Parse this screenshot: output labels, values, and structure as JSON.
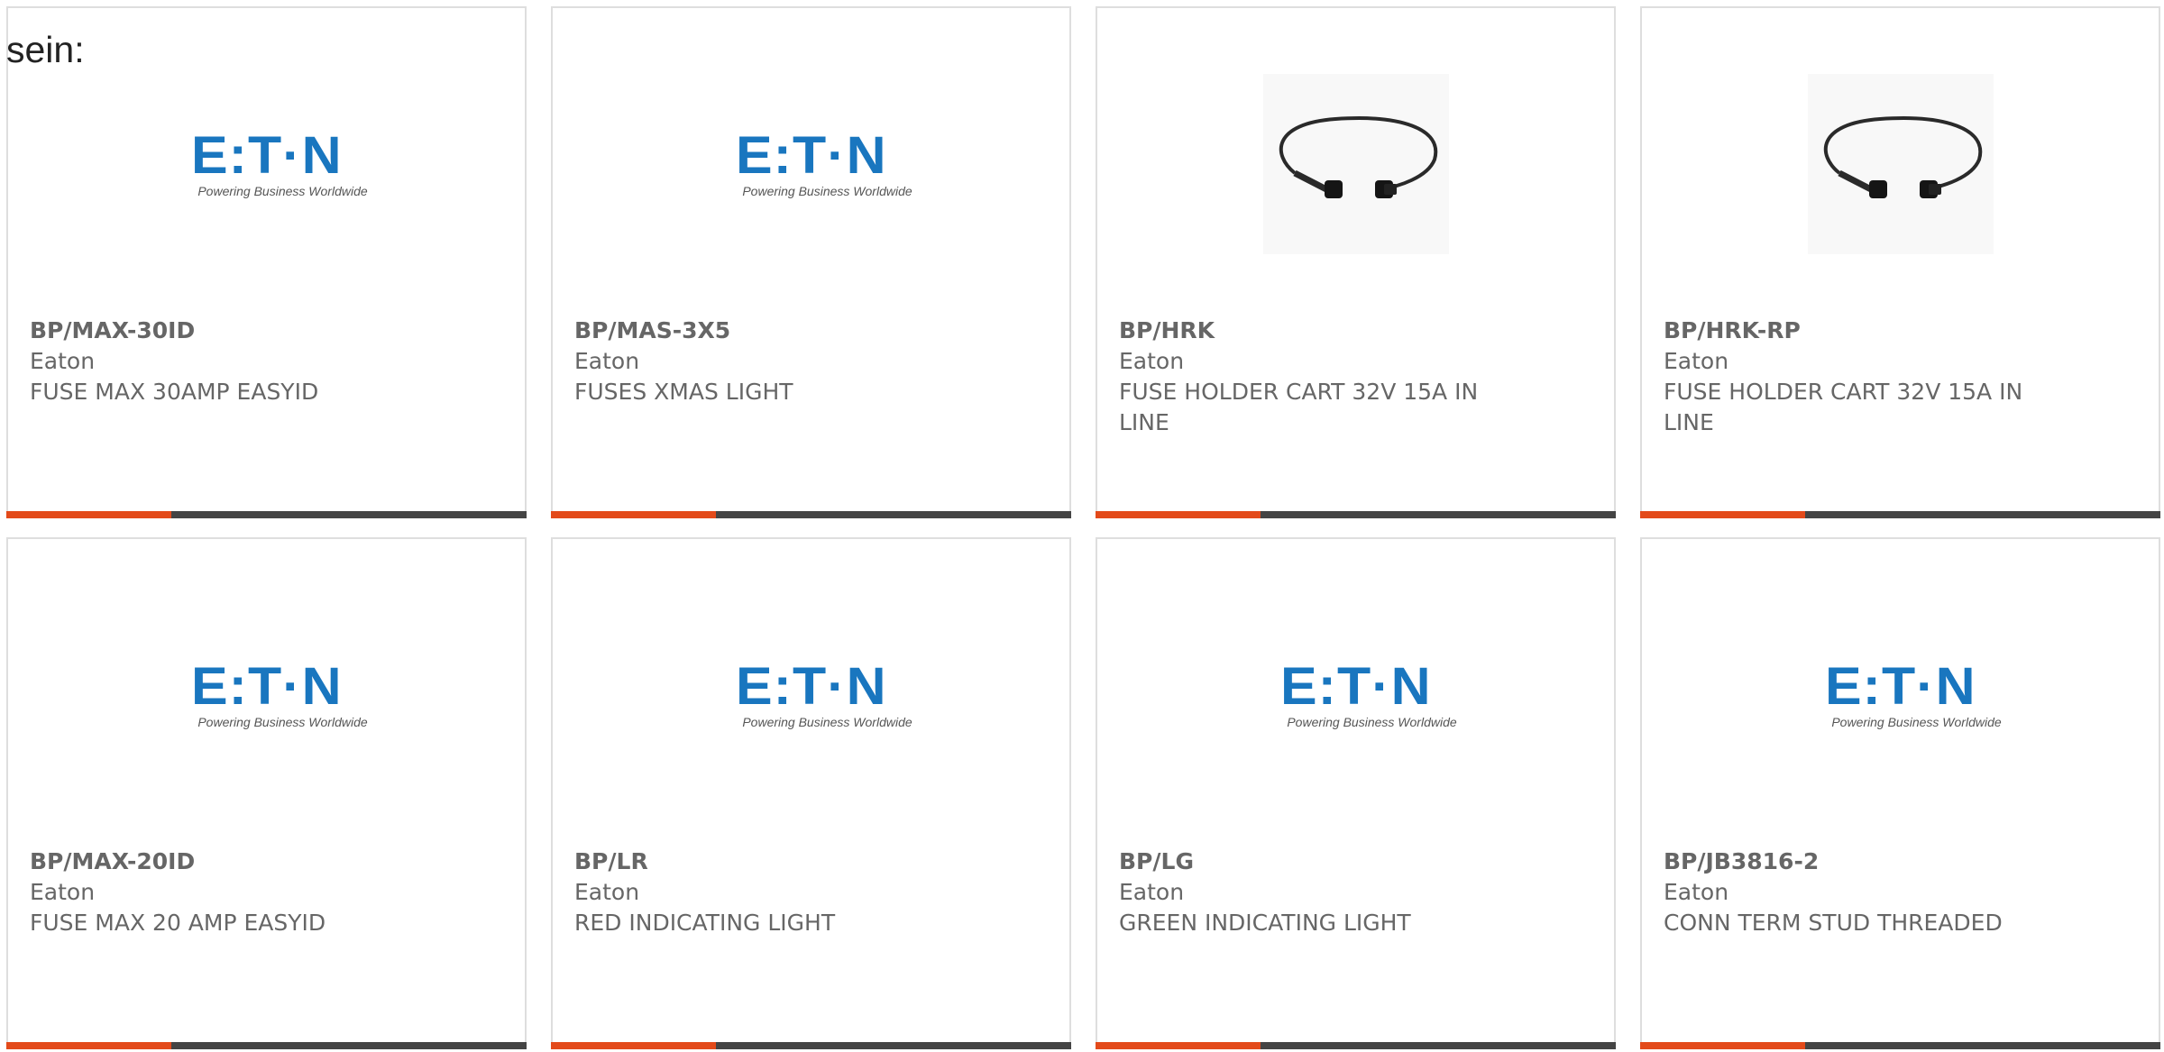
{
  "intro_text": "sein:",
  "brand": {
    "logo_word": "E:T·N",
    "logo_tagline": "Powering Business Worldwide",
    "logo_color": "#1976bf"
  },
  "colors": {
    "accent": "#e34a1a",
    "bar": "#444444",
    "text": "#666666",
    "border": "#dedede"
  },
  "products": [
    {
      "part_number": "BP/MAX-30ID",
      "manufacturer": "Eaton",
      "description": "FUSE MAX 30AMP EASYID",
      "image": "eaton-logo"
    },
    {
      "part_number": "BP/MAS-3X5",
      "manufacturer": "Eaton",
      "description": "FUSES XMAS LIGHT",
      "image": "eaton-logo"
    },
    {
      "part_number": "BP/HRK",
      "manufacturer": "Eaton",
      "description": "FUSE HOLDER CART 32V 15A IN LINE",
      "image": "cable-photo"
    },
    {
      "part_number": "BP/HRK-RP",
      "manufacturer": "Eaton",
      "description": "FUSE HOLDER CART 32V 15A IN LINE",
      "image": "cable-photo"
    },
    {
      "part_number": "BP/MAX-20ID",
      "manufacturer": "Eaton",
      "description": "FUSE MAX 20 AMP EASYID",
      "image": "eaton-logo"
    },
    {
      "part_number": "BP/LR",
      "manufacturer": "Eaton",
      "description": "RED INDICATING LIGHT",
      "image": "eaton-logo"
    },
    {
      "part_number": "BP/LG",
      "manufacturer": "Eaton",
      "description": "GREEN INDICATING LIGHT",
      "image": "eaton-logo"
    },
    {
      "part_number": "BP/JB3816-2",
      "manufacturer": "Eaton",
      "description": "CONN TERM STUD THREADED",
      "image": "eaton-logo"
    }
  ]
}
